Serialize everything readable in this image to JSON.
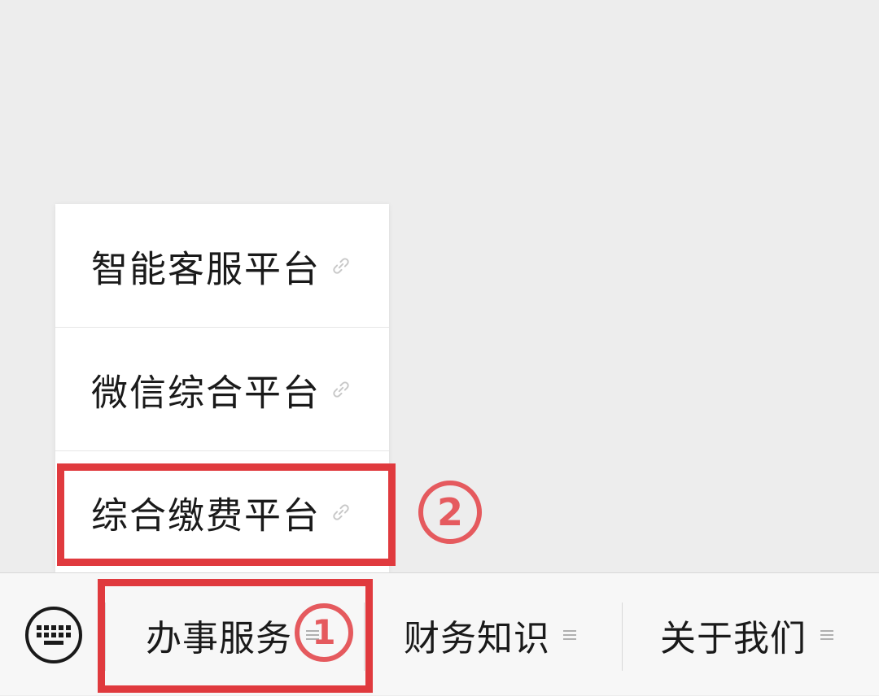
{
  "popup_menu": {
    "items": [
      {
        "label": "智能客服平台",
        "icon": "link-icon"
      },
      {
        "label": "微信综合平台",
        "icon": "link-icon"
      },
      {
        "label": "综合缴费平台",
        "icon": "link-icon"
      }
    ]
  },
  "bottom_menu": {
    "keyboard_icon": "keyboard-icon",
    "buttons": [
      {
        "label": "办事服务",
        "icon": "menu-lines-icon"
      },
      {
        "label": "财务知识",
        "icon": "menu-lines-icon"
      },
      {
        "label": "关于我们",
        "icon": "menu-lines-icon"
      }
    ]
  },
  "annotations": {
    "step1": "1",
    "step2": "2",
    "highlight_color": "#e03a3e",
    "badge_color": "#e55a5e"
  }
}
